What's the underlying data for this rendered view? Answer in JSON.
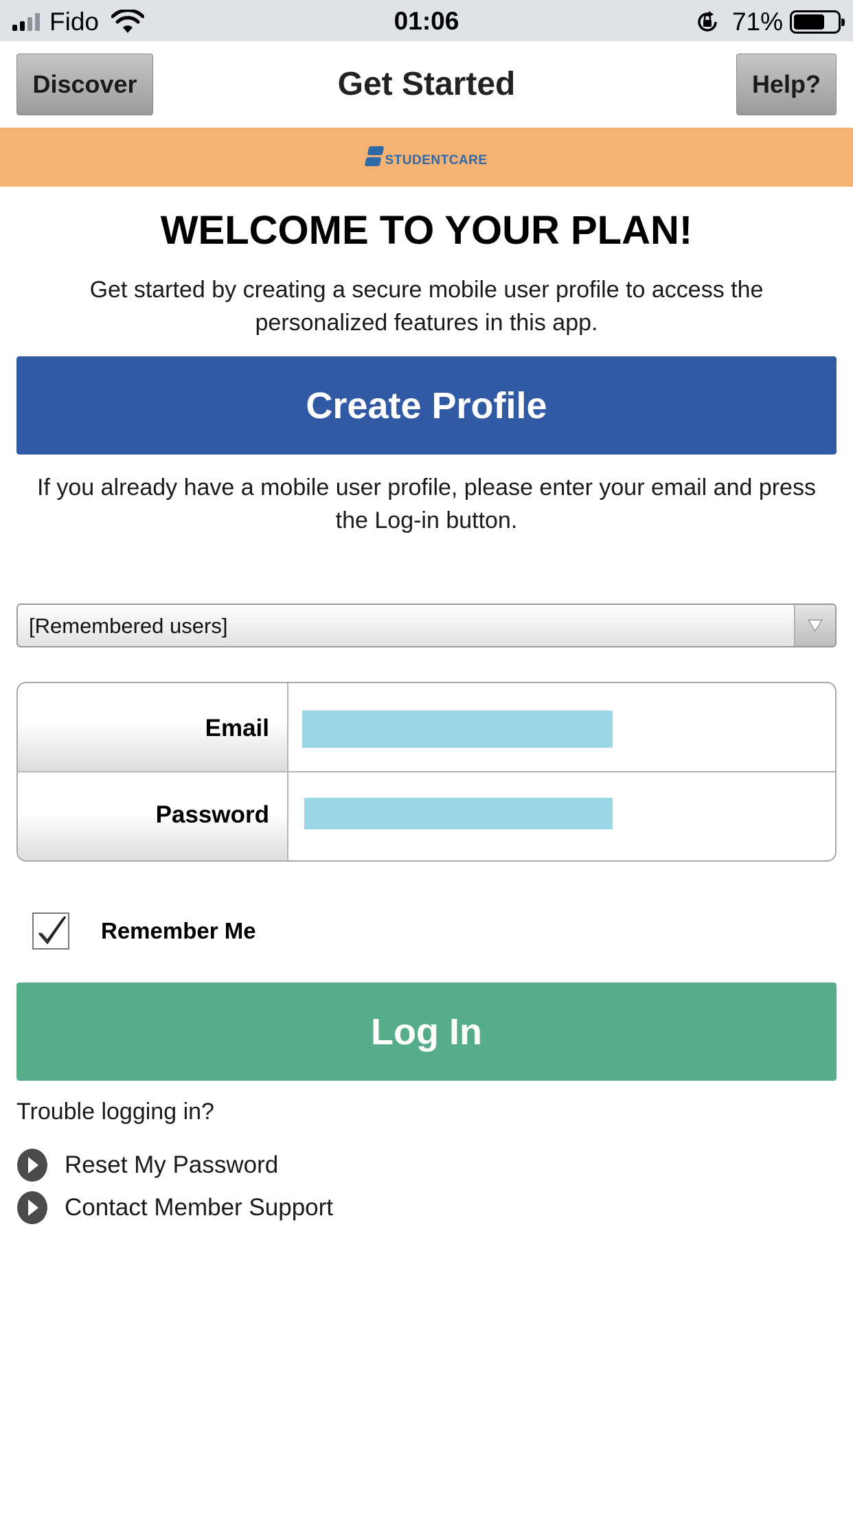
{
  "status_bar": {
    "carrier": "Fido",
    "time": "01:06",
    "battery_percent": "71%",
    "battery_level": 0.71
  },
  "nav": {
    "left_button": "Discover",
    "title": "Get Started",
    "right_button": "Help?"
  },
  "brand": {
    "logo_text": "STUDENTCARE",
    "band_color": "#f4b274"
  },
  "welcome": {
    "heading": "WELCOME TO YOUR PLAN!",
    "intro": "Get started by creating a secure mobile user profile to access the personalized features in this app."
  },
  "create_profile": {
    "label": "Create Profile",
    "color": "#3259a4"
  },
  "login_prompt": "If you already have a mobile user profile, please enter your email and press the Log-in button.",
  "remembered_users": {
    "selected": "[Remembered users]"
  },
  "form": {
    "email_label": "Email",
    "email_value": "",
    "password_label": "Password",
    "password_value": "",
    "field_color": "#9ad7e8"
  },
  "remember_me": {
    "label": "Remember Me",
    "checked": true
  },
  "login_button": {
    "label": "Log In",
    "color": "#55ad89"
  },
  "help_links": {
    "heading": "Trouble logging in?",
    "items": [
      {
        "label": "Reset My Password",
        "icon": "play-circle-icon"
      },
      {
        "label": "Contact Member Support",
        "icon": "play-circle-icon"
      }
    ]
  }
}
